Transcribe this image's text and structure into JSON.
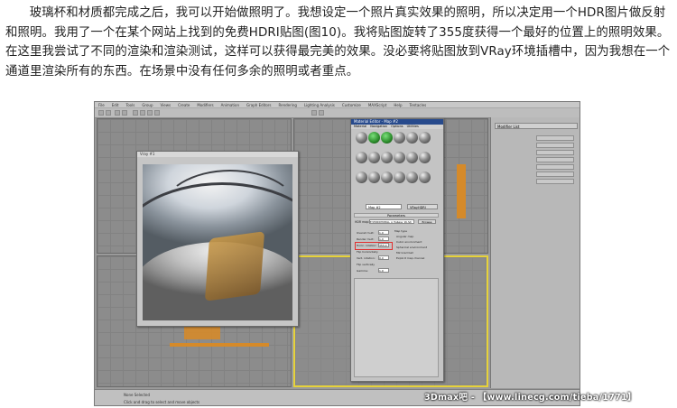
{
  "article": {
    "paragraph": "玻璃杯和材质都完成之后，我可以开始做照明了。我想设定一个照片真实效果的照明，所以决定用一个HDR图片做反射和照明。我用了一个在某个网站上找到的免费HDRI贴图(图10)。我将贴图旋转了355度获得一个最好的位置上的照明效果。在这里我尝试了不同的渲染和渲染测试，这样可以获得最完美的效果。没必要将贴图放到VRay环境插槽中，因为我想在一个通道里渲染所有的东西。在场景中没有任何多余的照明或者重点。"
  },
  "screenshot": {
    "menu_items": [
      "File",
      "Edit",
      "Tools",
      "Group",
      "Views",
      "Create",
      "Modifiers",
      "Animation",
      "Graph Editors",
      "Rendering",
      "Lighting Analysis",
      "Customize",
      "MAXScript",
      "Help",
      "Tentacles"
    ],
    "vray_window_title": "Vray #1",
    "material_editor_title": "Material Editor - Map #2",
    "material_editor_menu": [
      "Material",
      "Navigation",
      "Options",
      "Utilities"
    ],
    "map_name": "Map #2",
    "map_type": "VRayHDRI",
    "rollout_title": "Parameters",
    "hdr_map_label": "HDR map:",
    "hdr_map_file": "E:\\HDR\\DH036LL_A_Hallway_2K.hdr",
    "browse_label": "Browse",
    "overall_mult_label": "Overall mult:",
    "overall_mult_value": "1.0",
    "render_mult_label": "Render mult:",
    "render_mult_value": "1.0",
    "horiz_rotation_label": "Horiz. rotation:",
    "horiz_rotation_value": "355.0",
    "flip_horizontally_label": "Flip horizontally",
    "vert_rotation_label": "Vert. rotation:",
    "vert_rotation_value": "0.0",
    "flip_vertically_label": "Flip vertically",
    "gamma_label": "Gamma:",
    "gamma_value": "1.0",
    "map_type_group": "Map type",
    "map_type_options": [
      "Angular map",
      "Cubic environment",
      "Spherical environment",
      "Mirrored ball",
      "Explicit map channel"
    ],
    "modifier_list_label": "Modifier List",
    "status_text_1": "None Selected",
    "status_text_2": "Click and drag to select and move objects"
  },
  "watermark": "3Dmax吧 - 【www.linecg.com/tieba/1771】",
  "colors": {
    "viewport_gray": "#8c8c8c",
    "active_border": "#e6d23a",
    "orange_object": "#d58a2a",
    "highlight_red": "#e03030"
  }
}
